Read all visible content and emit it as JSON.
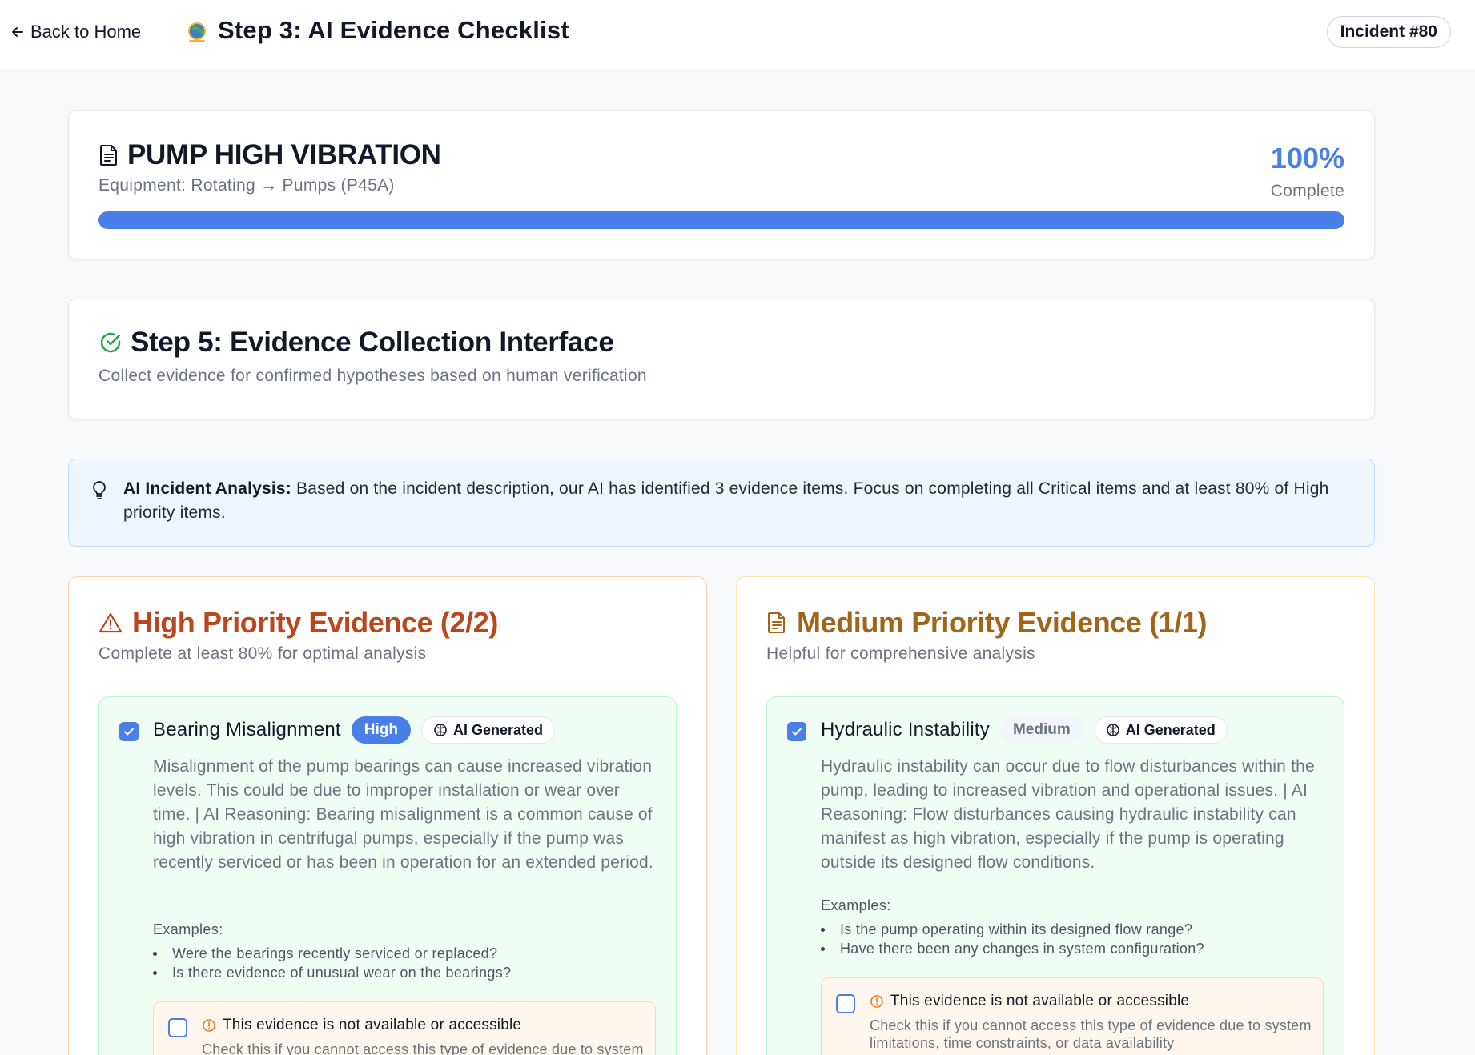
{
  "header": {
    "back_label": "Back to Home",
    "title": "Step 3: AI Evidence Checklist",
    "incident_badge": "Incident #80"
  },
  "incident": {
    "title": "PUMP HIGH VIBRATION",
    "equipment": "Equipment: Rotating → Pumps (P45A)",
    "progress_percent": "100%",
    "progress_label": "Complete",
    "progress_value": 1.0
  },
  "step": {
    "title": "Step 5: Evidence Collection Interface",
    "subtitle": "Collect evidence for confirmed hypotheses based on human verification"
  },
  "alert": {
    "label": "AI Incident Analysis:",
    "text": "Based on the incident description, our AI has identified 3 evidence items. Focus on completing all Critical items and at least 80% of High priority items."
  },
  "high": {
    "title": "High Priority Evidence (2/2)",
    "subtitle": "Complete at least 80% for optimal analysis",
    "item": {
      "title": "Bearing Misalignment",
      "priority": "High",
      "ai_badge": "AI Generated",
      "checked": true,
      "description": "Misalignment of the pump bearings can cause increased vibration levels. This could be due to improper installation or wear over time. | AI Reasoning: Bearing misalignment is a common cause of high vibration in centrifugal pumps, especially if the pump was recently serviced or has been in operation for an extended period.",
      "examples_label": "Examples:",
      "examples": [
        "Were the bearings recently serviced or replaced?",
        "Is there evidence of unusual wear on the bearings?"
      ],
      "na_title": "This evidence is not available or accessible",
      "na_desc": "Check this if you cannot access this type of evidence due to system limitations, time constraints, or data availability"
    }
  },
  "medium": {
    "title": "Medium Priority Evidence (1/1)",
    "subtitle": "Helpful for comprehensive analysis",
    "item": {
      "title": "Hydraulic Instability",
      "priority": "Medium",
      "ai_badge": "AI Generated",
      "checked": true,
      "description": "Hydraulic instability can occur due to flow disturbances within the pump, leading to increased vibration and operational issues. | AI Reasoning: Flow disturbances causing hydraulic instability can manifest as high vibration, especially if the pump is operating outside its designed flow conditions.",
      "examples_label": "Examples:",
      "examples": [
        "Is the pump operating within its designed flow range?",
        "Have there been any changes in system configuration?"
      ],
      "na_title": "This evidence is not available or accessible",
      "na_desc": "Check this if you cannot access this type of evidence due to system limitations, time constraints, or data availability"
    }
  },
  "colors": {
    "accent": "#4a7fe8",
    "high_title": "#b9461c",
    "medium_title": "#a1641a",
    "success": "#22a34a"
  }
}
